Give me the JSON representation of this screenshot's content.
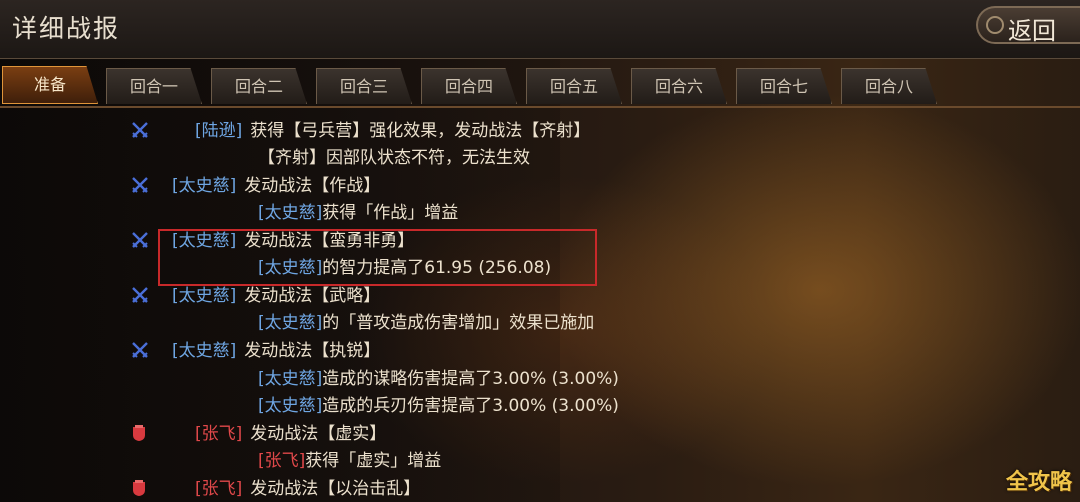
{
  "header": {
    "title": "详细战报",
    "back_label": "返回"
  },
  "tabs": [
    "准备",
    "回合一",
    "回合二",
    "回合三",
    "回合四",
    "回合五",
    "回合六",
    "回合七",
    "回合八"
  ],
  "log": [
    {
      "icon": "crossed-swords",
      "name": "[陆逊]",
      "faction": "blue",
      "text": "获得【弓兵营】强化效果，发动战法【齐射】"
    },
    {
      "icon": "",
      "name": "",
      "faction": "",
      "text": "【齐射】因部队状态不符，无法生效"
    },
    {
      "icon": "crossed-swords",
      "name": "[太史慈]",
      "faction": "blue",
      "text": "发动战法【作战】"
    },
    {
      "icon": "",
      "name": "[太史慈]",
      "faction": "blue",
      "text": "获得「作战」增益"
    },
    {
      "icon": "crossed-swords",
      "name": "[太史慈]",
      "faction": "blue",
      "text": "发动战法【蛮勇非勇】"
    },
    {
      "icon": "",
      "name": "[太史慈]",
      "faction": "blue",
      "text": "的智力提高了61.95 (256.08)"
    },
    {
      "icon": "crossed-swords",
      "name": "[太史慈]",
      "faction": "blue",
      "text": "发动战法【武略】"
    },
    {
      "icon": "",
      "name": "[太史慈]",
      "faction": "blue",
      "text": "的「普攻造成伤害增加」效果已施加"
    },
    {
      "icon": "crossed-swords",
      "name": "[太史慈]",
      "faction": "blue",
      "text": "发动战法【执锐】"
    },
    {
      "icon": "",
      "name": "[太史慈]",
      "faction": "blue",
      "text": "造成的谋略伤害提高了3.00% (3.00%)"
    },
    {
      "icon": "",
      "name": "[太史慈]",
      "faction": "blue",
      "text": "造成的兵刃伤害提高了3.00% (3.00%)"
    },
    {
      "icon": "shield",
      "name": "[张飞]",
      "faction": "red",
      "text": "发动战法【虚实】"
    },
    {
      "icon": "",
      "name": "[张飞]",
      "faction": "red",
      "text": "获得「虚实」增益"
    },
    {
      "icon": "shield",
      "name": "[张飞]",
      "faction": "red",
      "text": "发动战法【以治击乱】"
    }
  ],
  "watermark": "全攻略",
  "colors": {
    "blue_faction": "#6fa6e3",
    "red_faction": "#e0484a",
    "active_tab": "#e0953a",
    "highlight_box": "#c8292a"
  }
}
